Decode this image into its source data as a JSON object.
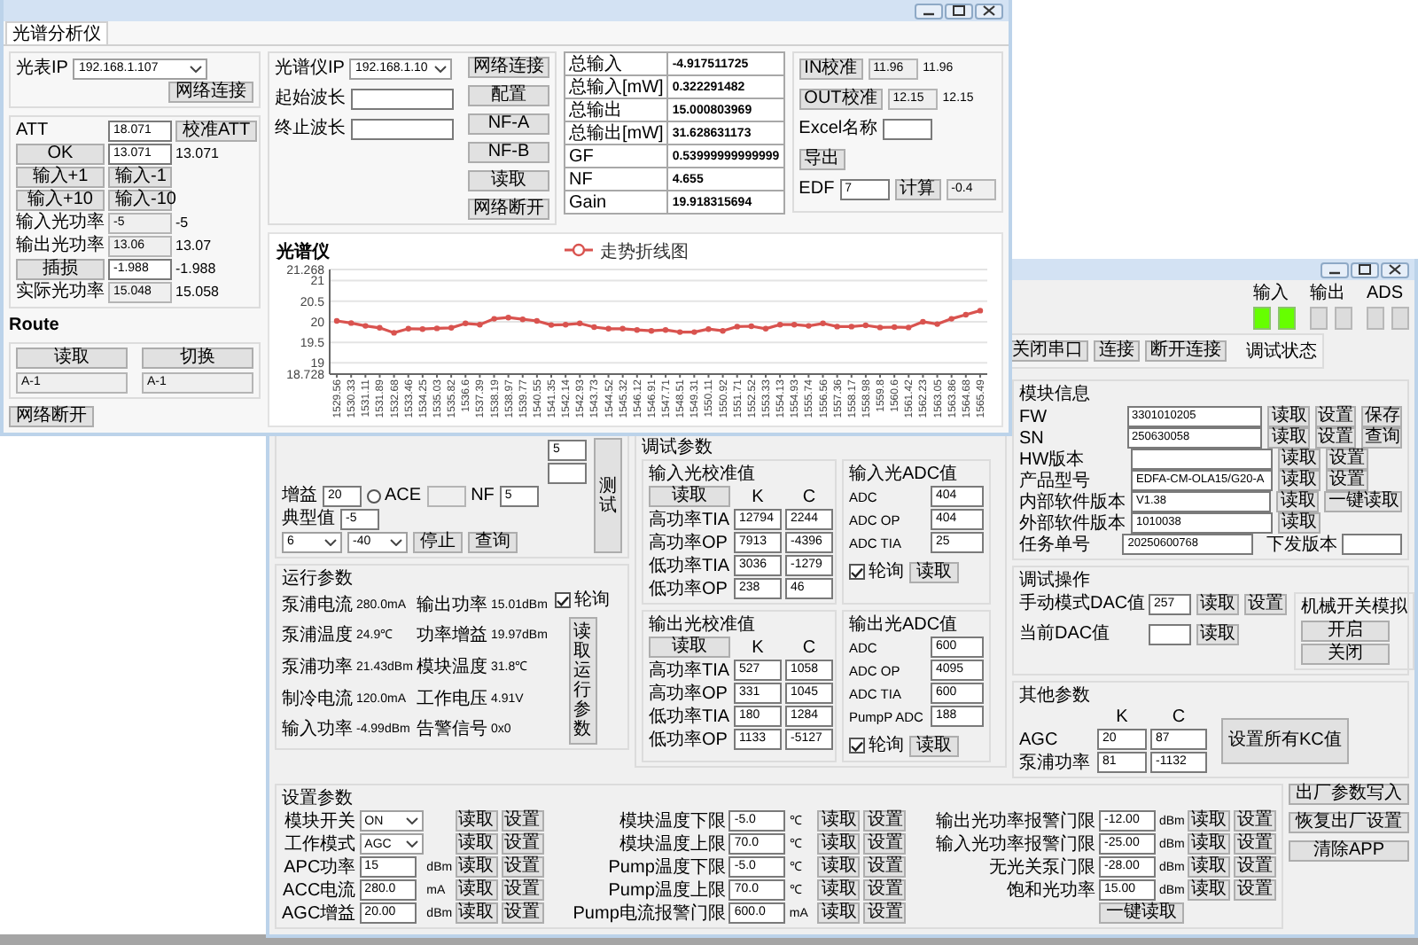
{
  "front_window": {
    "tab": {
      "label": "光谱分析仪",
      "selected": true
    },
    "meter": {
      "rows": [
        [
          {
            "kind": "label",
            "text": "光表IP"
          },
          {
            "kind": "combo",
            "value": "192.168.1.107"
          }
        ],
        [
          {
            "kind": "button",
            "text": "网络连接"
          }
        ]
      ]
    },
    "att": {
      "rows": [
        [
          {
            "kind": "label",
            "text": "ATT"
          },
          {
            "kind": "field",
            "value": "18.071",
            "readonly": false
          },
          {
            "kind": "button",
            "text": "校准ATT"
          }
        ],
        [
          {
            "kind": "button",
            "text": "OK"
          },
          {
            "kind": "field",
            "value": "13.071",
            "readonly": false
          },
          {
            "kind": "text",
            "text": "13.071"
          }
        ],
        [
          {
            "kind": "button",
            "text": "输入+1"
          },
          {
            "kind": "button",
            "text": "输入-1"
          }
        ],
        [
          {
            "kind": "button",
            "text": "输入+10"
          },
          {
            "kind": "button",
            "text": "输入-10"
          }
        ],
        [
          {
            "kind": "label",
            "text": "输入光功率"
          },
          {
            "kind": "field",
            "value": "-5",
            "readonly": true
          },
          {
            "kind": "text",
            "text": "-5"
          }
        ],
        [
          {
            "kind": "label",
            "text": "输出光功率"
          },
          {
            "kind": "field",
            "value": "13.06",
            "readonly": true
          },
          {
            "kind": "text",
            "text": "13.07"
          }
        ],
        [
          {
            "kind": "button",
            "text": "插损"
          },
          {
            "kind": "field",
            "value": "-1.988",
            "readonly": false
          },
          {
            "kind": "text",
            "text": "-1.988"
          }
        ],
        [
          {
            "kind": "label",
            "text": "实际光功率"
          },
          {
            "kind": "field",
            "value": "15.048",
            "readonly": true
          },
          {
            "kind": "text",
            "text": "15.058"
          }
        ]
      ]
    },
    "route": {
      "title": "Route",
      "rows": [
        [
          {
            "kind": "button",
            "text": "读取"
          },
          {
            "kind": "button",
            "text": "切换"
          }
        ],
        [
          {
            "kind": "field",
            "value": "A-1",
            "readonly": true
          },
          {
            "kind": "field",
            "value": "A-1",
            "readonly": true
          }
        ]
      ]
    },
    "disconnect": "网络断开",
    "spectrum": {
      "rows": [
        [
          {
            "kind": "label",
            "text": "光谱仪IP"
          },
          {
            "kind": "combo",
            "value": "192.168.1.10"
          }
        ],
        [
          {
            "kind": "label",
            "text": "起始波长"
          },
          {
            "kind": "field",
            "readonly": false
          }
        ],
        [
          {
            "kind": "label",
            "text": "终止波长"
          },
          {
            "kind": "field",
            "readonly": false
          }
        ]
      ],
      "buttons": [
        "网络连接",
        "配置",
        "NF-A",
        "NF-B",
        "读取",
        "网络断开"
      ]
    },
    "results": [
      {
        "name": "总输入",
        "value": "-4.917511725"
      },
      {
        "name": "总输入[mW]",
        "value": "0.322291482"
      },
      {
        "name": "总输出",
        "value": "15.000803969"
      },
      {
        "name": "总输出[mW]",
        "value": "31.628631173"
      },
      {
        "name": "GF",
        "value": "0.53999999999999"
      },
      {
        "name": "NF",
        "value": "4.655"
      },
      {
        "name": "Gain",
        "value": "19.918315694"
      }
    ],
    "calib": {
      "in_row": {
        "button": "IN校准",
        "value": "11.96",
        "readonly": true,
        "reading": "11.96"
      },
      "out_row": {
        "button": "OUT校准",
        "value": "12.15",
        "readonly": true,
        "reading": "12.15"
      },
      "excel": {
        "label": "Excel名称",
        "readonly": false
      },
      "export_button": "导出",
      "edf": {
        "label": "EDF",
        "value": "7",
        "readonly": false,
        "button": "计算",
        "result": "-0.4",
        "result_readonly": true
      }
    },
    "chart": {
      "chart_data": {
        "type": "line",
        "title": "光谱仪",
        "categories": [
          "1529.56",
          "1530.33",
          "1531.11",
          "1531.89",
          "1532.68",
          "1533.46",
          "1534.25",
          "1535.03",
          "1535.82",
          "1536.6",
          "1537.39",
          "1538.19",
          "1538.97",
          "1539.77",
          "1540.55",
          "1541.35",
          "1542.14",
          "1542.93",
          "1543.73",
          "1544.52",
          "1545.32",
          "1546.12",
          "1546.91",
          "1547.71",
          "1548.51",
          "1549.31",
          "1550.11",
          "1550.92",
          "1551.71",
          "1552.52",
          "1553.33",
          "1554.13",
          "1554.93",
          "1555.74",
          "1556.56",
          "1557.36",
          "1558.17",
          "1558.98",
          "1559.8",
          "1560.6",
          "1561.42",
          "1562.23",
          "1563.05",
          "1563.86",
          "1564.68",
          "1565.49"
        ],
        "series": [
          {
            "name": "走势折线图",
            "color": "#d9534f",
            "marker": "circle",
            "values": [
              20.02,
              19.97,
              19.9,
              19.85,
              19.73,
              19.83,
              19.82,
              19.84,
              19.85,
              19.96,
              19.93,
              20.07,
              20.1,
              20.06,
              20.02,
              19.92,
              19.93,
              19.96,
              19.87,
              19.83,
              19.83,
              19.8,
              19.78,
              19.8,
              19.75,
              19.75,
              19.82,
              19.78,
              19.88,
              19.89,
              19.83,
              19.93,
              19.93,
              19.9,
              19.96,
              19.88,
              19.88,
              19.91,
              19.86,
              19.87,
              19.86,
              20.0,
              19.94,
              20.07,
              20.17,
              20.27
            ]
          }
        ],
        "ylim": [
          18.728,
          21.268
        ],
        "grid": true,
        "yticks": [
          18.728,
          19,
          19.5,
          20,
          20.5,
          21,
          21.268
        ]
      }
    }
  },
  "back_window": {
    "toolbar": {
      "buttons": [
        "关闭串口",
        "连接",
        "断开连接"
      ],
      "status": "调试状态"
    },
    "indicators": [
      {
        "label": "输入",
        "leds": [
          {
            "on": true
          },
          {
            "on": true
          }
        ]
      },
      {
        "label": "输出",
        "leds": [
          {
            "on": false
          },
          {
            "on": false
          }
        ]
      },
      {
        "label": "ADS",
        "leds": [
          {
            "on": false
          },
          {
            "on": false
          }
        ]
      }
    ],
    "test": {
      "rows": [
        [
          {
            "kind": "field",
            "value": "5",
            "readonly": false
          }
        ],
        [
          {
            "kind": "field",
            "readonly": false
          }
        ],
        [
          {
            "kind": "label",
            "text": "增益"
          },
          {
            "kind": "field",
            "value": "20",
            "readonly": false
          },
          {
            "kind": "radio",
            "text": "ACE",
            "selected": false
          },
          {
            "kind": "field",
            "readonly": true
          },
          {
            "kind": "label",
            "text": "NF"
          },
          {
            "kind": "field",
            "value": "5",
            "readonly": false
          }
        ],
        [
          {
            "kind": "label",
            "text": "典型值"
          },
          {
            "kind": "field",
            "value": "-5",
            "readonly": false
          }
        ],
        [
          {
            "kind": "combo",
            "value": "6"
          },
          {
            "kind": "combo",
            "value": "-40"
          },
          {
            "kind": "button",
            "text": "停止"
          },
          {
            "kind": "button",
            "text": "查询"
          }
        ]
      ],
      "side_button": "测试"
    },
    "run_params": {
      "title": "运行参数",
      "items": [
        {
          "label": "泵浦电流",
          "value": "280.0mA"
        },
        {
          "label": "输出功率",
          "value": "15.01dBm"
        },
        {
          "label": "泵浦温度",
          "value": "24.9℃"
        },
        {
          "label": "功率增益",
          "value": "19.97dBm"
        },
        {
          "label": "泵浦功率",
          "value": "21.43dBm"
        },
        {
          "label": "模块温度",
          "value": "31.8℃"
        },
        {
          "label": "制冷电流",
          "value": "120.0mA"
        },
        {
          "label": "工作电压",
          "value": "4.91V"
        },
        {
          "label": "输入功率",
          "value": "-4.99dBm"
        },
        {
          "label": "告警信号",
          "value": "0x0"
        }
      ],
      "poll": {
        "label": "轮询",
        "checked": true
      },
      "button": "读取运行参数"
    },
    "debug_params": {
      "title": "调试参数",
      "blocks": [
        {
          "kind": "kc",
          "title": "输入光校准值",
          "button": "读取",
          "headers": [
            "K",
            "C"
          ],
          "rows": [
            {
              "label": "高功率TIA",
              "k": "12794",
              "c": "2244"
            },
            {
              "label": "高功率OP",
              "k": "7913",
              "c": "-4396"
            },
            {
              "label": "低功率TIA",
              "k": "3036",
              "c": "-1279"
            },
            {
              "label": "低功率OP",
              "k": "238",
              "c": "46"
            }
          ]
        },
        {
          "kind": "adc",
          "title": "输入光ADC值",
          "rows": [
            {
              "label": "ADC",
              "value": "404"
            },
            {
              "label": "ADC OP",
              "value": "404"
            },
            {
              "label": "ADC TIA",
              "value": "25"
            }
          ],
          "poll": {
            "label": "轮询",
            "checked": true
          },
          "button": "读取"
        },
        {
          "kind": "kc",
          "title": "输出光校准值",
          "button": "读取",
          "headers": [
            "K",
            "C"
          ],
          "rows": [
            {
              "label": "高功率TIA",
              "k": "527",
              "c": "1058"
            },
            {
              "label": "高功率OP",
              "k": "331",
              "c": "1045"
            },
            {
              "label": "低功率TIA",
              "k": "180",
              "c": "1284"
            },
            {
              "label": "低功率OP",
              "k": "1133",
              "c": "-5127"
            }
          ]
        },
        {
          "kind": "adc",
          "title": "输出光ADC值",
          "rows": [
            {
              "label": "ADC",
              "value": "600"
            },
            {
              "label": "ADC OP",
              "value": "4095"
            },
            {
              "label": "ADC TIA",
              "value": "600"
            },
            {
              "label": "PumpP ADC",
              "value": "188"
            }
          ],
          "poll": {
            "label": "轮询",
            "checked": true
          },
          "button": "读取"
        }
      ]
    },
    "module_info": {
      "title": "模块信息",
      "rows": [
        {
          "label": "FW",
          "value": "3301010205",
          "buttons": [
            "读取",
            "设置",
            "保存"
          ]
        },
        {
          "label": "SN",
          "value": "250630058",
          "buttons": [
            "读取",
            "设置",
            "查询"
          ]
        },
        {
          "label": "HW版本",
          "buttons": [
            "读取",
            "设置"
          ]
        },
        {
          "label": "产品型号",
          "value": "EDFA-CM-OLA15/G20-A",
          "buttons": [
            "读取",
            "设置"
          ]
        },
        {
          "label": "内部软件版本",
          "value": "V1.38",
          "buttons": [
            "读取",
            "一键读取"
          ]
        },
        {
          "label": "外部软件版本",
          "value": "1010038",
          "buttons": [
            "读取"
          ]
        },
        {
          "label": "任务单号",
          "value": "20250600768",
          "extra_label": "下发版本"
        }
      ]
    },
    "debug_ops": {
      "title": "调试操作",
      "rows": [
        {
          "label": "手动模式DAC值",
          "value": "257",
          "buttons": [
            "读取",
            "设置"
          ]
        },
        {
          "label": "当前DAC值",
          "buttons": [
            "读取"
          ]
        }
      ],
      "switch": {
        "title": "机械开关模拟",
        "buttons": [
          "开启",
          "关闭"
        ]
      }
    },
    "other_params": {
      "title": "其他参数",
      "headers": [
        "K",
        "C"
      ],
      "rows": [
        {
          "label": "AGC",
          "k": "20",
          "c": "87"
        },
        {
          "label": "泵浦功率",
          "k": "81",
          "c": "-1132"
        }
      ],
      "button": "设置所有KC值"
    },
    "settings": {
      "title": "设置参数",
      "columns": [
        [
          {
            "kind": "combo",
            "label": "模块开关",
            "value": "ON",
            "buttons": [
              "读取",
              "设置"
            ]
          },
          {
            "kind": "combo",
            "label": "工作模式",
            "value": "AGC",
            "buttons": [
              "读取",
              "设置"
            ]
          },
          {
            "kind": "field",
            "label": "APC功率",
            "value": "15",
            "unit": "dBm",
            "buttons": [
              "读取",
              "设置"
            ]
          },
          {
            "kind": "field",
            "label": "ACC电流",
            "value": "280.0",
            "unit": "mA",
            "buttons": [
              "读取",
              "设置"
            ]
          },
          {
            "kind": "field",
            "label": "AGC增益",
            "value": "20.00",
            "unit": "dBm",
            "buttons": [
              "读取",
              "设置"
            ]
          }
        ],
        [
          {
            "kind": "field",
            "label": "模块温度下限",
            "value": "-5.0",
            "unit": "℃",
            "buttons": [
              "读取",
              "设置"
            ]
          },
          {
            "kind": "field",
            "label": "模块温度上限",
            "value": "70.0",
            "unit": "℃",
            "buttons": [
              "读取",
              "设置"
            ]
          },
          {
            "kind": "field",
            "label": "Pump温度下限",
            "value": "-5.0",
            "unit": "℃",
            "buttons": [
              "读取",
              "设置"
            ]
          },
          {
            "kind": "field",
            "label": "Pump温度上限",
            "value": "70.0",
            "unit": "℃",
            "buttons": [
              "读取",
              "设置"
            ]
          },
          {
            "kind": "field",
            "label": "Pump电流报警门限",
            "value": "600.0",
            "unit": "mA",
            "buttons": [
              "读取",
              "设置"
            ]
          }
        ],
        [
          {
            "kind": "field",
            "label": "输出光功率报警门限",
            "value": "-12.00",
            "unit": "dBm",
            "buttons": [
              "读取",
              "设置"
            ]
          },
          {
            "kind": "field",
            "label": "输入光功率报警门限",
            "value": "-25.00",
            "unit": "dBm",
            "buttons": [
              "读取",
              "设置"
            ]
          },
          {
            "kind": "field",
            "label": "无光关泵门限",
            "value": "-28.00",
            "unit": "dBm",
            "buttons": [
              "读取",
              "设置"
            ]
          },
          {
            "kind": "field",
            "label": "饱和光功率",
            "value": "15.00",
            "unit": "dBm",
            "buttons": [
              "读取",
              "设置"
            ]
          },
          {
            "kind": "action",
            "button": "一键读取"
          }
        ]
      ],
      "side_buttons": [
        "出厂参数写入",
        "恢复出厂设置",
        "清除APP"
      ]
    }
  }
}
